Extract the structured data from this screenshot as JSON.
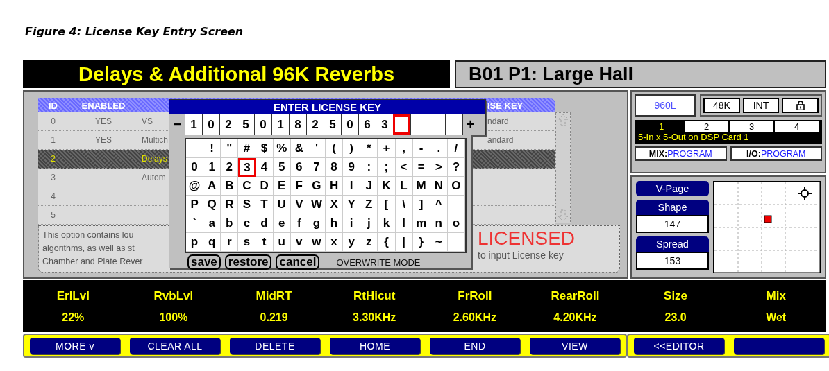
{
  "caption": "Figure 4: License Key Entry Screen",
  "header": {
    "title": "Delays & Additional 96K Reverbs",
    "preset": "B01 P1: Large Hall"
  },
  "table": {
    "columns": {
      "id": "ID",
      "enabled": "ENABLED",
      "license_key": "ISE KEY"
    },
    "rows": [
      {
        "id": "0",
        "enabled": "YES",
        "name": "VS",
        "license_key": "ndard",
        "selected": false
      },
      {
        "id": "1",
        "enabled": "YES",
        "name": "Multich",
        "license_key": "andard",
        "selected": false
      },
      {
        "id": "2",
        "name": "Delays",
        "selected": true
      },
      {
        "id": "3",
        "name": "Autom",
        "selected": false
      },
      {
        "id": "4",
        "selected": false
      },
      {
        "id": "5",
        "selected": false
      }
    ]
  },
  "description": {
    "lines": [
      "This option contains lou",
      "algorithms, as well as st",
      "Chamber and Plate Rever"
    ],
    "status": "LICENSED",
    "hint": "to input License key"
  },
  "dialog": {
    "title": "ENTER LICENSE KEY",
    "decrement": "−",
    "increment": "+",
    "slots": [
      {
        "char": "1",
        "selected": false
      },
      {
        "char": "0",
        "selected": false
      },
      {
        "char": "2",
        "selected": false
      },
      {
        "char": "5",
        "selected": false
      },
      {
        "char": "0",
        "selected": false
      },
      {
        "char": "1",
        "selected": false
      },
      {
        "char": "8",
        "selected": false
      },
      {
        "char": "2",
        "selected": false
      },
      {
        "char": "5",
        "selected": false
      },
      {
        "char": "0",
        "selected": false
      },
      {
        "char": "6",
        "selected": false
      },
      {
        "char": "3",
        "selected": false
      },
      {
        "selected": true
      },
      {
        "selected": false
      },
      {
        "selected": false
      },
      {
        "selected": false
      }
    ],
    "keys": [
      [
        {
          "selected": false
        },
        {
          "char": "!",
          "selected": false
        },
        {
          "char": "\"",
          "selected": false
        },
        {
          "char": "#",
          "selected": false
        },
        {
          "char": "$",
          "selected": false
        },
        {
          "char": "%",
          "selected": false
        },
        {
          "char": "&",
          "selected": false
        },
        {
          "char": "'",
          "selected": false
        },
        {
          "char": "(",
          "selected": false
        },
        {
          "char": ")",
          "selected": false
        },
        {
          "char": "*",
          "selected": false
        },
        {
          "char": "+",
          "selected": false
        },
        {
          "char": ",",
          "selected": false
        },
        {
          "char": "-",
          "selected": false
        },
        {
          "char": ".",
          "selected": false
        },
        {
          "char": "/",
          "selected": false
        }
      ],
      [
        {
          "char": "0",
          "selected": false
        },
        {
          "char": "1",
          "selected": false
        },
        {
          "char": "2",
          "selected": false
        },
        {
          "char": "3",
          "selected": true
        },
        {
          "char": "4",
          "selected": false
        },
        {
          "char": "5",
          "selected": false
        },
        {
          "char": "6",
          "selected": false
        },
        {
          "char": "7",
          "selected": false
        },
        {
          "char": "8",
          "selected": false
        },
        {
          "char": "9",
          "selected": false
        },
        {
          "char": ":",
          "selected": false
        },
        {
          "char": ";",
          "selected": false
        },
        {
          "char": "<",
          "selected": false
        },
        {
          "char": "=",
          "selected": false
        },
        {
          "char": ">",
          "selected": false
        },
        {
          "char": "?",
          "selected": false
        }
      ],
      [
        {
          "char": "@",
          "selected": false
        },
        {
          "char": "A",
          "selected": false
        },
        {
          "char": "B",
          "selected": false
        },
        {
          "char": "C",
          "selected": false
        },
        {
          "char": "D",
          "selected": false
        },
        {
          "char": "E",
          "selected": false
        },
        {
          "char": "F",
          "selected": false
        },
        {
          "char": "G",
          "selected": false
        },
        {
          "char": "H",
          "selected": false
        },
        {
          "char": "I",
          "selected": false
        },
        {
          "char": "J",
          "selected": false
        },
        {
          "char": "K",
          "selected": false
        },
        {
          "char": "L",
          "selected": false
        },
        {
          "char": "M",
          "selected": false
        },
        {
          "char": "N",
          "selected": false
        },
        {
          "char": "O",
          "selected": false
        }
      ],
      [
        {
          "char": "P",
          "selected": false
        },
        {
          "char": "Q",
          "selected": false
        },
        {
          "char": "R",
          "selected": false
        },
        {
          "char": "S",
          "selected": false
        },
        {
          "char": "T",
          "selected": false
        },
        {
          "char": "U",
          "selected": false
        },
        {
          "char": "V",
          "selected": false
        },
        {
          "char": "W",
          "selected": false
        },
        {
          "char": "X",
          "selected": false
        },
        {
          "char": "Y",
          "selected": false
        },
        {
          "char": "Z",
          "selected": false
        },
        {
          "char": "[",
          "selected": false
        },
        {
          "char": "\\",
          "selected": false
        },
        {
          "char": "]",
          "selected": false
        },
        {
          "char": "^",
          "selected": false
        },
        {
          "char": "_",
          "selected": false
        }
      ],
      [
        {
          "char": "`",
          "selected": false
        },
        {
          "char": "a",
          "selected": false
        },
        {
          "char": "b",
          "selected": false
        },
        {
          "char": "c",
          "selected": false
        },
        {
          "char": "d",
          "selected": false
        },
        {
          "char": "e",
          "selected": false
        },
        {
          "char": "f",
          "selected": false
        },
        {
          "char": "g",
          "selected": false
        },
        {
          "char": "h",
          "selected": false
        },
        {
          "char": "i",
          "selected": false
        },
        {
          "char": "j",
          "selected": false
        },
        {
          "char": "k",
          "selected": false
        },
        {
          "char": "l",
          "selected": false
        },
        {
          "char": "m",
          "selected": false
        },
        {
          "char": "n",
          "selected": false
        },
        {
          "char": "o",
          "selected": false
        }
      ],
      [
        {
          "char": "p",
          "selected": false
        },
        {
          "char": "q",
          "selected": false
        },
        {
          "char": "r",
          "selected": false
        },
        {
          "char": "s",
          "selected": false
        },
        {
          "char": "t",
          "selected": false
        },
        {
          "char": "u",
          "selected": false
        },
        {
          "char": "v",
          "selected": false
        },
        {
          "char": "w",
          "selected": false
        },
        {
          "char": "x",
          "selected": false
        },
        {
          "char": "y",
          "selected": false
        },
        {
          "char": "z",
          "selected": false
        },
        {
          "char": "{",
          "selected": false
        },
        {
          "char": "|",
          "selected": false
        },
        {
          "char": "}",
          "selected": false
        },
        {
          "char": "~",
          "selected": false
        },
        {
          "selected": false
        }
      ]
    ],
    "actions": [
      "save",
      "restore",
      "cancel"
    ],
    "mode": "OVERWRITE MODE"
  },
  "status": {
    "algorithm": "960L",
    "rate": "48K",
    "clock": "INT",
    "cards": [
      {
        "label": "1",
        "selected": true
      },
      {
        "label": "2",
        "selected": false
      },
      {
        "label": "3",
        "selected": false
      },
      {
        "label": "4",
        "selected": false
      }
    ],
    "card_info": "5-In x 5-Out on DSP Card 1",
    "mix": {
      "label": "MIX:",
      "value": "PROGRAM"
    },
    "io": {
      "label": "I/O:",
      "value": "PROGRAM"
    }
  },
  "controls": {
    "vpage": "V-Page",
    "params": [
      {
        "label": "Shape",
        "value": "147"
      },
      {
        "label": "Spread",
        "value": "153"
      }
    ]
  },
  "parameters": [
    {
      "label": "ErlLvl",
      "value": "22%"
    },
    {
      "label": "RvbLvl",
      "value": "100%"
    },
    {
      "label": "MidRT",
      "value": "0.219"
    },
    {
      "label": "RtHicut",
      "value": "3.30KHz"
    },
    {
      "label": "FrRoll",
      "value": "2.60KHz"
    },
    {
      "label": "RearRoll",
      "value": "4.20KHz"
    },
    {
      "label": "Size",
      "value": "23.0"
    },
    {
      "label": "Mix",
      "value": "Wet"
    }
  ],
  "softkeys": [
    {
      "kind": "label",
      "label": "MORE v"
    },
    {
      "kind": "label",
      "label": "CLEAR ALL"
    },
    {
      "kind": "label",
      "label": "DELETE"
    },
    {
      "kind": "label",
      "label": "HOME"
    },
    {
      "kind": "label",
      "label": "END"
    },
    {
      "kind": "label",
      "label": "VIEW"
    }
  ],
  "softkeys_right": [
    {
      "kind": "label",
      "label": "<<EDITOR"
    },
    {
      "kind": "blank"
    }
  ]
}
